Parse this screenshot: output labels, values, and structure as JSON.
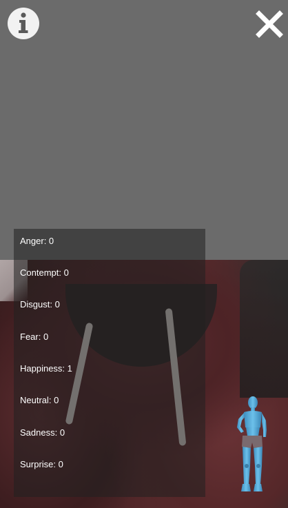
{
  "header": {
    "info_icon": "info-icon",
    "close_icon": "close-icon"
  },
  "emotions": [
    {
      "label": "Anger: 0"
    },
    {
      "label": "Contempt: 0"
    },
    {
      "label": "Disgust: 0"
    },
    {
      "label": "Fear: 0"
    },
    {
      "label": "Happiness: 1"
    },
    {
      "label": "Neutral: 0"
    },
    {
      "label": "Sadness: 0"
    },
    {
      "label": "Surprise: 0"
    }
  ],
  "avatar": {
    "icon": "avatar-figure",
    "color": "#5fb0dc"
  },
  "colors": {
    "background": "#6b6b6b",
    "panel": "#202020",
    "text": "#ffffff"
  }
}
